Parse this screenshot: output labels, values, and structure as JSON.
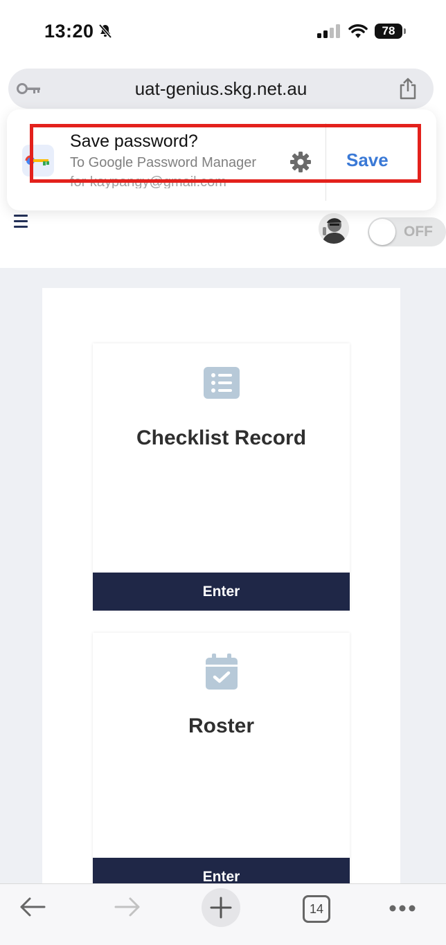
{
  "status_bar": {
    "time": "13:20",
    "battery": "78",
    "icons": [
      "bell-slash-icon",
      "signal-icon",
      "wifi-icon",
      "battery-icon"
    ]
  },
  "browser": {
    "url": "uat-genius.skg.net.au",
    "icons": [
      "key-icon",
      "share-icon"
    ]
  },
  "password_prompt": {
    "title": "Save password?",
    "subtitle": "To Google Password Manager",
    "account_line": "for kaypangy@gmail.com",
    "save_label": "Save",
    "highlight_color": "#e3211c",
    "save_color": "#3a79d6"
  },
  "header": {
    "toggle_label": "OFF"
  },
  "cards": [
    {
      "title": "Checklist Record",
      "button_label": "Enter",
      "icon": "checklist-icon"
    },
    {
      "title": "Roster",
      "button_label": "Enter",
      "icon": "calendar-check-icon"
    }
  ],
  "toolbar": {
    "tab_count": "14",
    "icons": [
      "back-arrow-icon",
      "forward-arrow-icon",
      "plus-icon",
      "tabs-icon",
      "more-icon"
    ]
  },
  "colors": {
    "card_button": "#1f2747",
    "icon_tint": "#b7c9d8",
    "page_background": "#eef0f4"
  }
}
